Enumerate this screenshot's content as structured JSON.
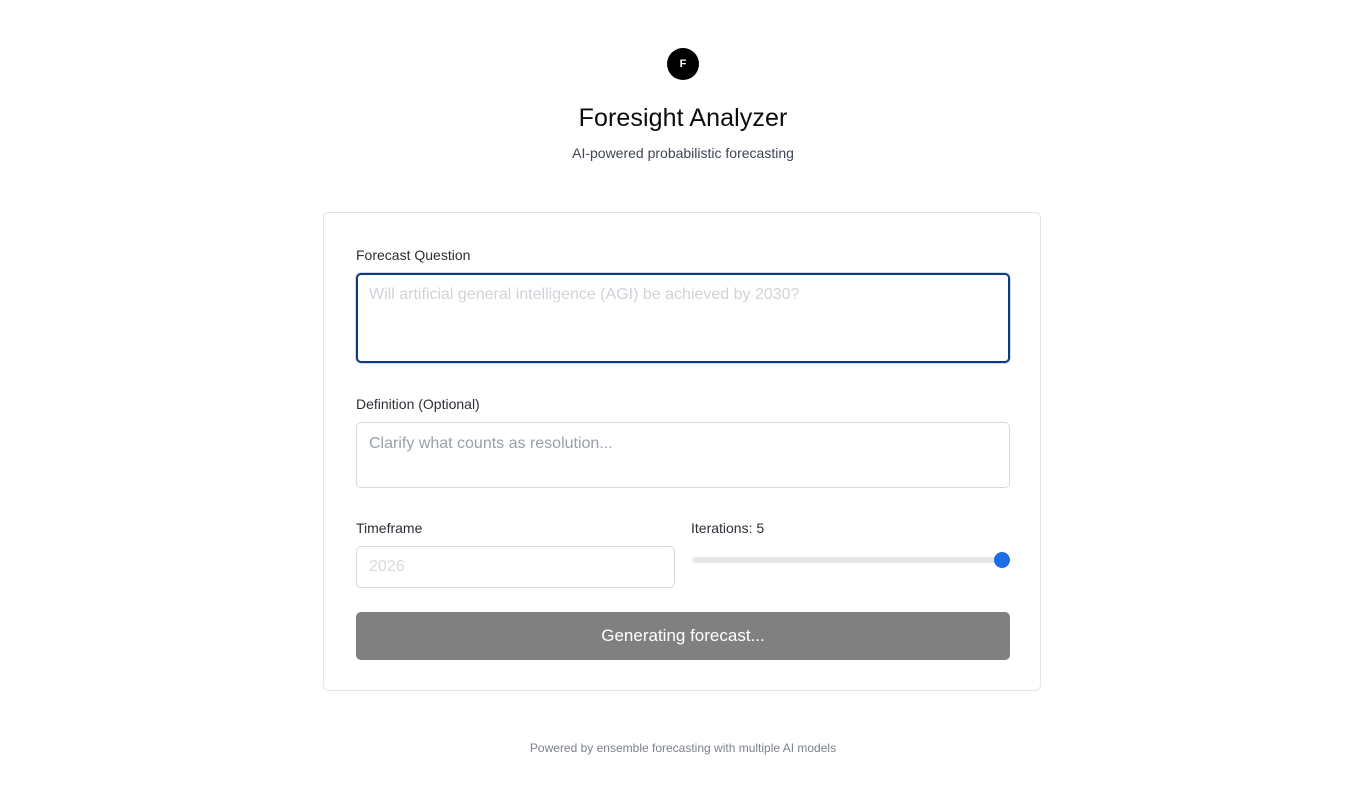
{
  "header": {
    "logo_letter": "F",
    "title": "Foresight Analyzer",
    "subtitle": "AI-powered probabilistic forecasting"
  },
  "form": {
    "question": {
      "label": "Forecast Question",
      "placeholder": "Will artificial general intelligence (AGI) be achieved by 2030?",
      "value": ""
    },
    "definition": {
      "label": "Definition (Optional)",
      "placeholder": "Clarify what counts as resolution...",
      "value": ""
    },
    "timeframe": {
      "label": "Timeframe",
      "placeholder": "2026",
      "value": ""
    },
    "iterations": {
      "label": "Iterations: 5",
      "value": 5,
      "min": 1,
      "max": 5,
      "accent_color": "#1a6fe8"
    },
    "submit_label": "Generating forecast..."
  },
  "footer": {
    "text": "Powered by ensemble forecasting with multiple AI models"
  }
}
